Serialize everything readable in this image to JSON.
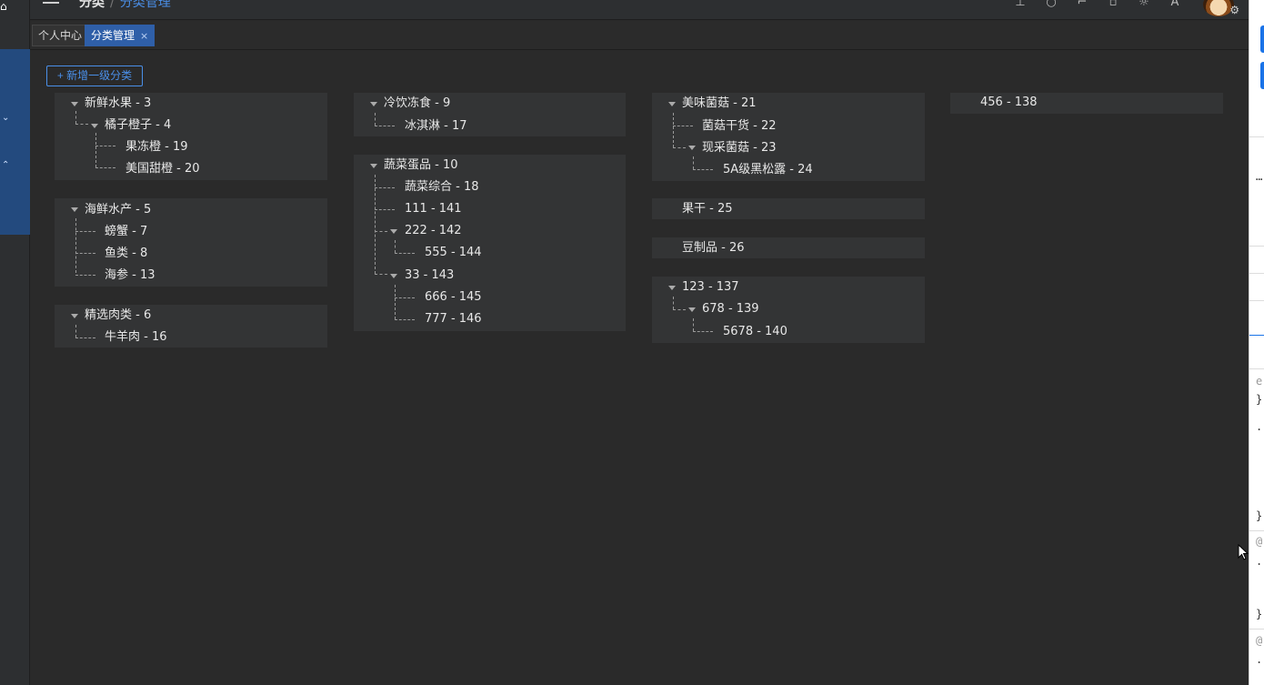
{
  "sidebar": {
    "top_icon": "home-icon",
    "chevron_down": "⌄",
    "chevron_up": "⌃"
  },
  "header": {
    "breadcrumb_root": "分类",
    "breadcrumb_current": "分类管理",
    "tool_icons": [
      "pin-icon",
      "search-icon",
      "fullscreen-icon",
      "clipboard-icon",
      "theme-icon",
      "translate-icon"
    ],
    "settings_icon": "gear-icon"
  },
  "tabs": [
    {
      "label": "个人中心"
    },
    {
      "label": "分类管理",
      "close": "×"
    }
  ],
  "toolbar": {
    "add_label": "+ 新增一级分类"
  },
  "trees": [
    {
      "root": "新鲜水果 - 3",
      "children": [
        "橘子橙子 - 4",
        "果冻橙 - 19",
        "美国甜橙 - 20"
      ]
    },
    {
      "root": "海鲜水产 - 5",
      "children": [
        "螃蟹 - 7",
        "鱼类 - 8",
        "海参 - 13"
      ]
    },
    {
      "root": "精选肉类 - 6",
      "children": [
        "牛羊肉 - 16"
      ]
    },
    {
      "root": "冷饮冻食 - 9",
      "children": [
        "冰淇淋 - 17"
      ]
    },
    {
      "root": "蔬菜蛋品 - 10",
      "children": [
        "蔬菜综合 - 18",
        "111 - 141",
        "222 - 142",
        "555 - 144",
        "33 - 143",
        "666 - 145",
        "777 - 146"
      ]
    },
    {
      "root": "美味菌菇 - 21",
      "children": [
        "菌菇干货 - 22",
        "现采菌菇 - 23",
        "5A级黑松露 - 24"
      ]
    },
    {
      "root": "果干 - 25",
      "children": []
    },
    {
      "root": "豆制品 - 26",
      "children": []
    },
    {
      "root": "123 - 137",
      "children": [
        "678 - 139",
        "5678 - 140"
      ]
    },
    {
      "root": "456 - 138",
      "children": []
    }
  ],
  "colors": {
    "accent": "#4a8fe8",
    "active_tab": "#2f5fa8",
    "card_bg": "#333435",
    "page_bg": "#2a2a2a"
  }
}
